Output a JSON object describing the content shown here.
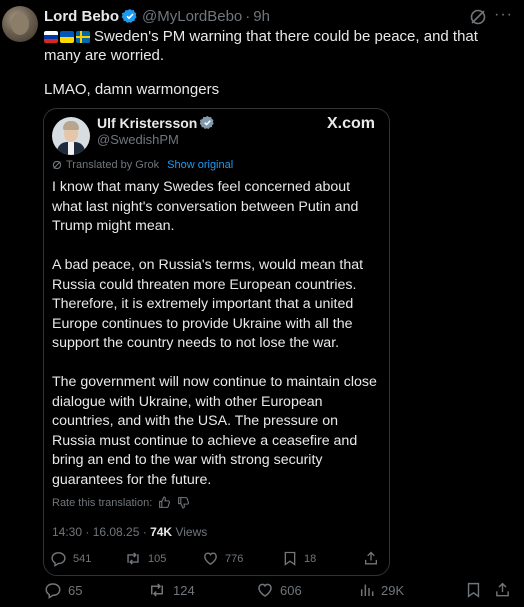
{
  "tweet": {
    "author_name": "Lord Bebo",
    "handle": "@MyLordBebo",
    "time": "9h",
    "text_line": "Sweden's PM warning that there could be peace, and that many are worried.",
    "flags": [
      "russia-flag",
      "ukraine-flag",
      "sweden-flag"
    ],
    "comment": "LMAO, damn warmongers",
    "actions": {
      "replies": "65",
      "reposts": "124",
      "likes": "606",
      "views": "29K"
    }
  },
  "quote": {
    "author_name": "Ulf Kristersson",
    "handle": "@SwedishPM",
    "brand": "X.com",
    "translated_by": "Translated by Grok",
    "show_original": "Show original",
    "paragraphs": [
      "I know that many Swedes feel concerned about what last night's conversation between Putin and Trump might mean.",
      "A bad peace, on Russia's terms, would mean that Russia could threaten more European countries. Therefore, it is extremely important that a united Europe continues to provide Ukraine with all the support the country needs to not lose the war.",
      "The government will now continue to maintain close dialogue with Ukraine, with other European countries, and with the USA. The pressure on Russia must continue to achieve a ceasefire and bring an end to the war with strong security guarantees for the future."
    ],
    "rate_translation": "Rate this translation:",
    "timestamp": "14:30 · 16.08.25 ·",
    "views_count": "74K",
    "views_label": "Views",
    "actions": {
      "replies": "541",
      "reposts": "105",
      "likes": "776",
      "bookmarks": "18"
    }
  },
  "colors": {
    "background": "#000000",
    "text": "#e7e9ea",
    "muted": "#71767b",
    "accent": "#1d9bf0",
    "border": "#2f3336"
  }
}
